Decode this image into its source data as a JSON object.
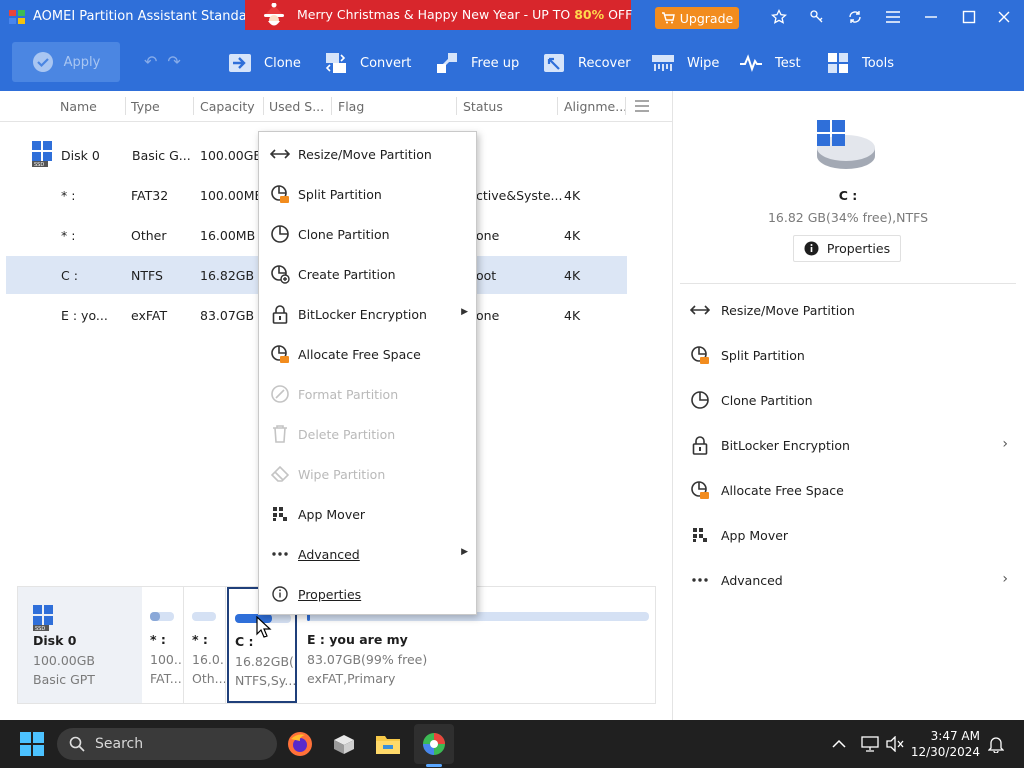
{
  "window": {
    "title": "AOMEI Partition Assistant Standa...",
    "promo_text_before": "Merry Christmas & Happy New Year - UP TO ",
    "promo_highlight": "80%",
    "promo_text_after": " OFF",
    "upgrade_label": "Upgrade"
  },
  "toolbar": {
    "apply_label": "Apply",
    "items": [
      {
        "label": "Clone",
        "icon": "clone-icon"
      },
      {
        "label": "Convert",
        "icon": "convert-icon"
      },
      {
        "label": "Free up",
        "icon": "free-up-icon"
      },
      {
        "label": "Recover",
        "icon": "recover-icon"
      },
      {
        "label": "Wipe",
        "icon": "wipe-icon"
      },
      {
        "label": "Test",
        "icon": "test-icon"
      },
      {
        "label": "Tools",
        "icon": "tools-icon"
      }
    ]
  },
  "table": {
    "columns": [
      "Name",
      "Type",
      "Capacity",
      "Used S...",
      "Flag",
      "Status",
      "Alignme..."
    ],
    "rows": [
      {
        "name": "Disk 0",
        "type": "Basic G...",
        "capacity": "100.00GB",
        "used": "",
        "flag": "",
        "status": "",
        "align": ""
      },
      {
        "name": "* :",
        "type": "FAT32",
        "capacity": "100.00MB",
        "used": "",
        "flag": "",
        "status": "ctive&Syste...",
        "align": "4K"
      },
      {
        "name": "* :",
        "type": "Other",
        "capacity": "16.00MB",
        "used": "",
        "flag": "",
        "status": "one",
        "align": "4K"
      },
      {
        "name": "C :",
        "type": "NTFS",
        "capacity": "16.82GB",
        "used": "",
        "flag": "",
        "status": "oot",
        "align": "4K"
      },
      {
        "name": "E : yo...",
        "type": "exFAT",
        "capacity": "83.07GB",
        "used": "",
        "flag": "",
        "status": "one",
        "align": "4K"
      }
    ]
  },
  "context_menu": {
    "items": [
      {
        "label": "Resize/Move Partition",
        "icon": "resize-icon",
        "enabled": true
      },
      {
        "label": "Split Partition",
        "icon": "split-icon",
        "enabled": true
      },
      {
        "label": "Clone Partition",
        "icon": "clone-partition-icon",
        "enabled": true
      },
      {
        "label": "Create Partition",
        "icon": "create-partition-icon",
        "enabled": true
      },
      {
        "label": "BitLocker Encryption",
        "icon": "lock-icon",
        "enabled": true,
        "submenu": true
      },
      {
        "label": "Allocate Free Space",
        "icon": "allocate-icon",
        "enabled": true
      },
      {
        "label": "Format Partition",
        "icon": "format-icon",
        "enabled": false
      },
      {
        "label": "Delete Partition",
        "icon": "trash-icon",
        "enabled": false
      },
      {
        "label": "Wipe Partition",
        "icon": "eraser-icon",
        "enabled": false
      },
      {
        "label": "App Mover",
        "icon": "app-mover-icon",
        "enabled": true
      },
      {
        "label": "Advanced",
        "icon": "more-icon",
        "enabled": true,
        "submenu": true
      },
      {
        "label": "Properties",
        "icon": "info-icon",
        "enabled": true
      }
    ]
  },
  "disk_map": {
    "disk_name": "Disk 0",
    "disk_size": "100.00GB",
    "disk_type": "Basic GPT",
    "partitions": [
      {
        "name": "* :",
        "line1": "100....",
        "line2": "FAT...",
        "used_fraction": 0.4
      },
      {
        "name": "* :",
        "line1": "16.0...",
        "line2": "Oth...",
        "used_fraction": 0.0
      },
      {
        "name": "C :",
        "line1": "16.82GB(...",
        "line2": "NTFS,Sy...",
        "used_fraction": 0.66
      },
      {
        "name": "E : you are my",
        "line1": "83.07GB(99% free)",
        "line2": "exFAT,Primary",
        "used_fraction": 0.01
      }
    ]
  },
  "right_panel": {
    "partition_name": "C :",
    "partition_info": "16.82 GB(34% free),NTFS",
    "properties_label": "Properties",
    "actions": [
      {
        "label": "Resize/Move Partition",
        "icon": "resize-icon",
        "submenu": false
      },
      {
        "label": "Split Partition",
        "icon": "split-icon",
        "submenu": false
      },
      {
        "label": "Clone Partition",
        "icon": "clone-partition-icon",
        "submenu": false
      },
      {
        "label": "BitLocker Encryption",
        "icon": "lock-icon",
        "submenu": true
      },
      {
        "label": "Allocate Free Space",
        "icon": "allocate-icon",
        "submenu": false
      },
      {
        "label": "App Mover",
        "icon": "app-mover-icon",
        "submenu": false
      },
      {
        "label": "Advanced",
        "icon": "more-icon",
        "submenu": true
      }
    ]
  },
  "taskbar": {
    "search_label": "Search",
    "time": "3:47 AM",
    "date": "12/30/2024"
  },
  "colors": {
    "brand_blue": "#2f6fd9",
    "promo_red": "#d8262c",
    "upgrade_orange": "#f28c1e",
    "selected_row": "#dce6f5"
  }
}
